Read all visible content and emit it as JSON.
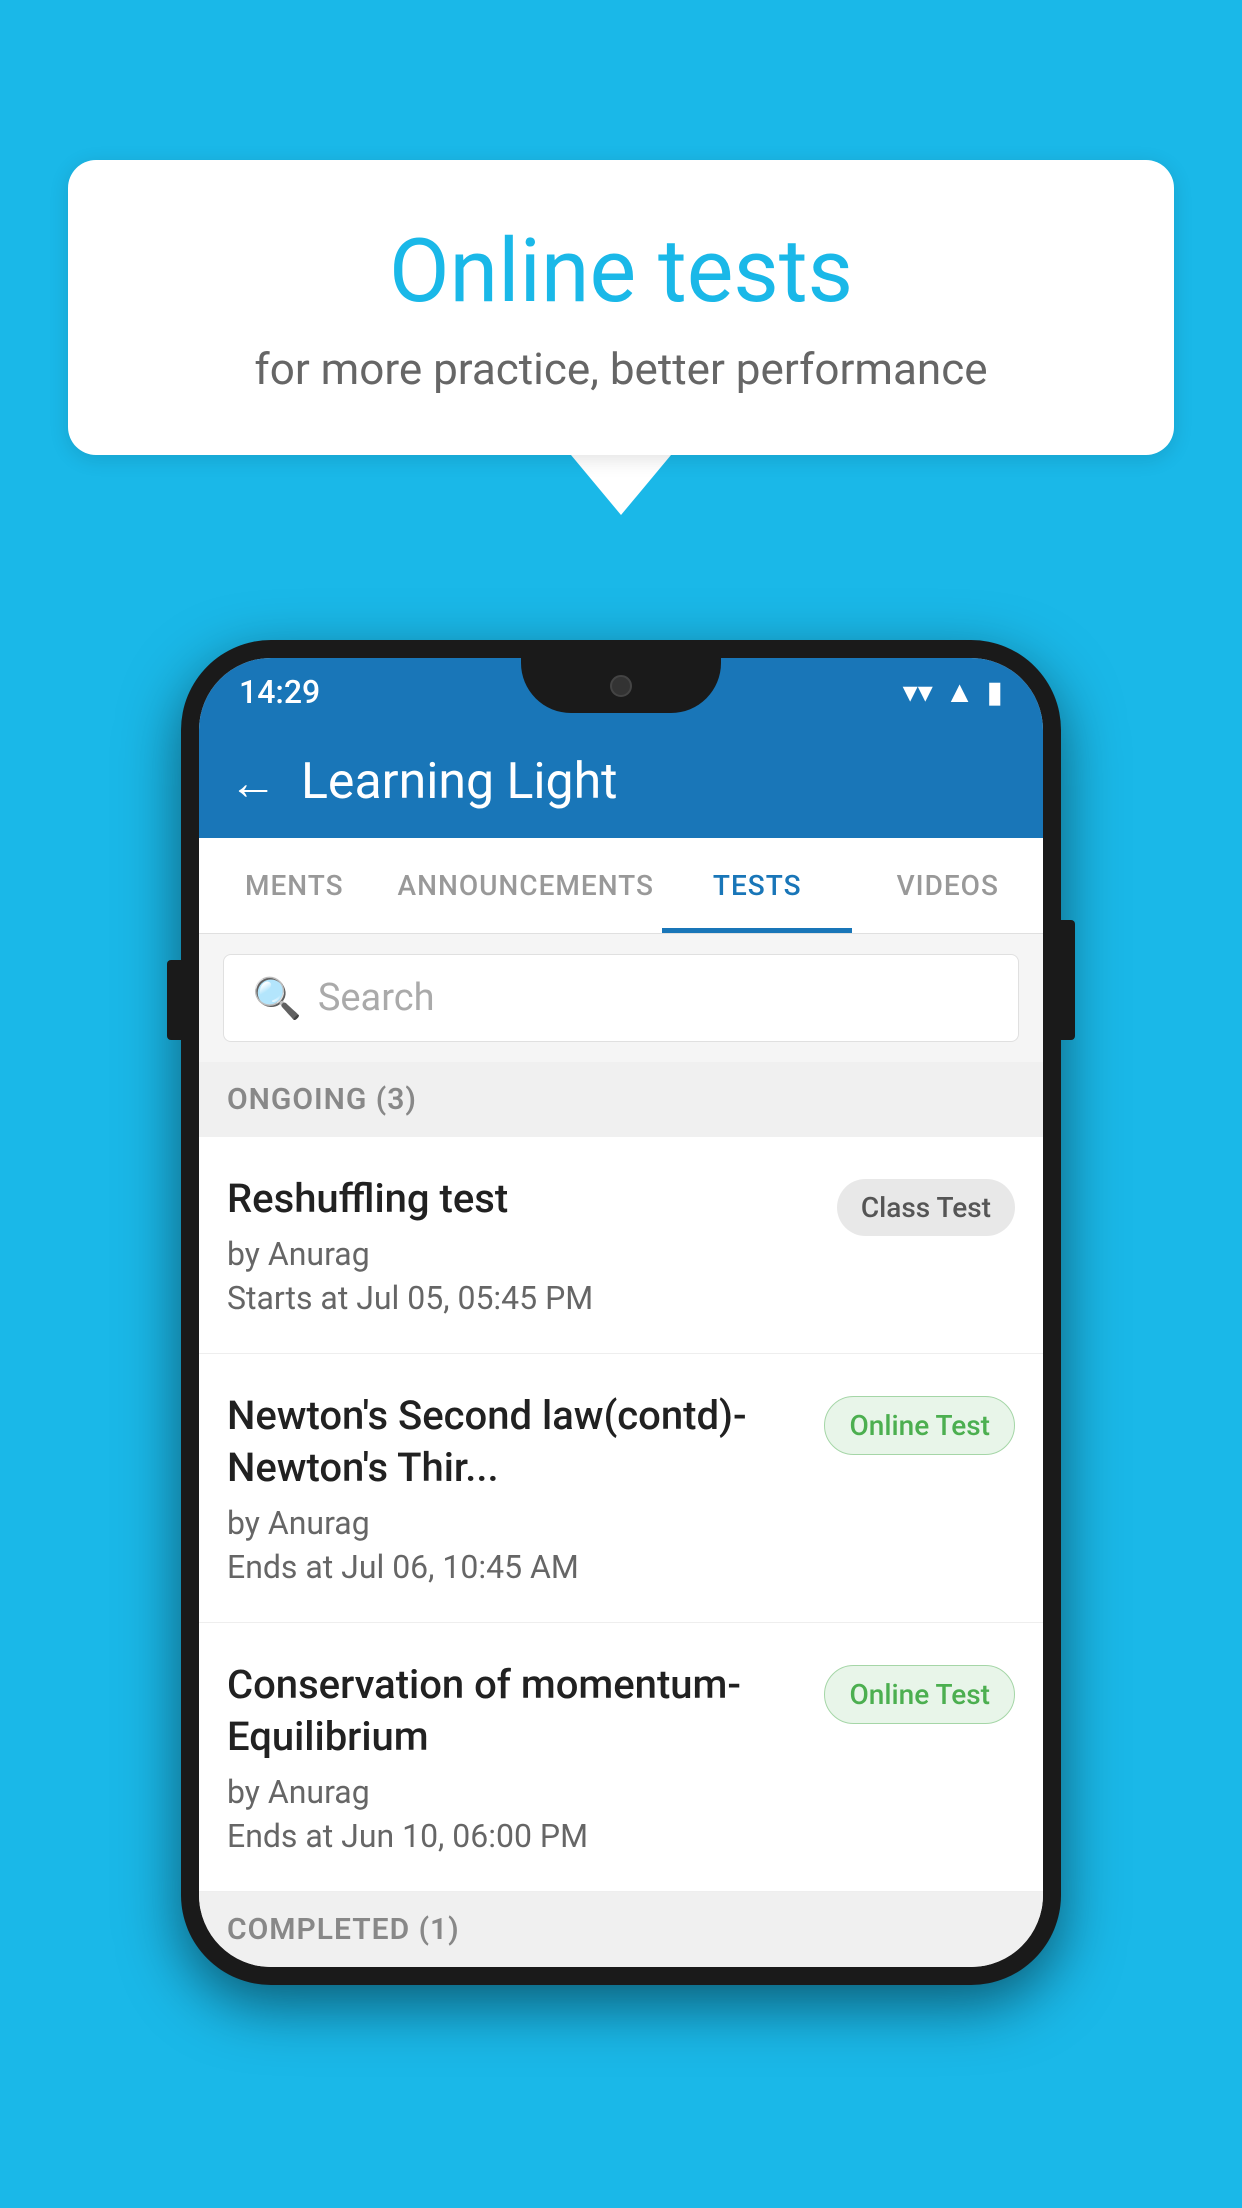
{
  "background": {
    "color": "#1ab8e8"
  },
  "speech_bubble": {
    "title": "Online tests",
    "subtitle": "for more practice, better performance"
  },
  "phone": {
    "status_bar": {
      "time": "14:29",
      "wifi_icon": "▼",
      "signal_icon": "▲",
      "battery_icon": "▮"
    },
    "app_bar": {
      "back_icon": "←",
      "title": "Learning Light"
    },
    "tabs": [
      {
        "label": "MENTS",
        "active": false
      },
      {
        "label": "ANNOUNCEMENTS",
        "active": false
      },
      {
        "label": "TESTS",
        "active": true
      },
      {
        "label": "VIDEOS",
        "active": false
      }
    ],
    "search": {
      "placeholder": "Search",
      "icon": "🔍"
    },
    "sections": [
      {
        "name": "ONGOING (3)",
        "tests": [
          {
            "name": "Reshuffling test",
            "author": "by Anurag",
            "date_label": "Starts at",
            "date": "Jul 05, 05:45 PM",
            "badge": "Class Test",
            "badge_type": "class"
          },
          {
            "name": "Newton's Second law(contd)-Newton's Thir...",
            "author": "by Anurag",
            "date_label": "Ends at",
            "date": "Jul 06, 10:45 AM",
            "badge": "Online Test",
            "badge_type": "online"
          },
          {
            "name": "Conservation of momentum-Equilibrium",
            "author": "by Anurag",
            "date_label": "Ends at",
            "date": "Jun 10, 06:00 PM",
            "badge": "Online Test",
            "badge_type": "online"
          }
        ]
      }
    ],
    "completed_section": {
      "name": "COMPLETED (1)"
    }
  }
}
